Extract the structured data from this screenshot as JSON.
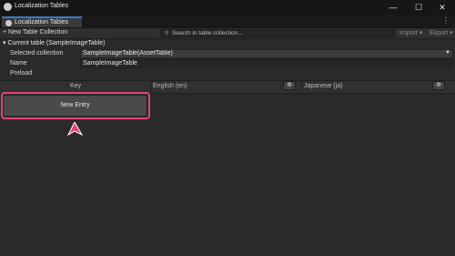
{
  "window": {
    "title": "Localization Tables",
    "controls": {
      "minimize": "—",
      "maximize": "☐",
      "close": "✕"
    }
  },
  "tabs": [
    {
      "label": "Localization Tables"
    }
  ],
  "toolbar": {
    "new_collection_label": "+ New Table Collection",
    "search_placeholder": "Search in table collection...",
    "import_label": "Import ▾",
    "export_label": "Export ▾"
  },
  "current_table": {
    "header": "▾ Current table (SampleImageTable)",
    "selected_collection_label": "Selected collection",
    "selected_collection_value": "SampleImageTable(AssetTable)",
    "name_label": "Name",
    "name_value": "SampleImageTable",
    "preload_label": "Preload",
    "preload_checked": false
  },
  "grid": {
    "columns": [
      "Key",
      "English (en)",
      "Japanese (ja)"
    ]
  },
  "new_entry_label": "New Entry",
  "colors": {
    "highlight": "#e2437c",
    "accent": "#3a79c4"
  }
}
